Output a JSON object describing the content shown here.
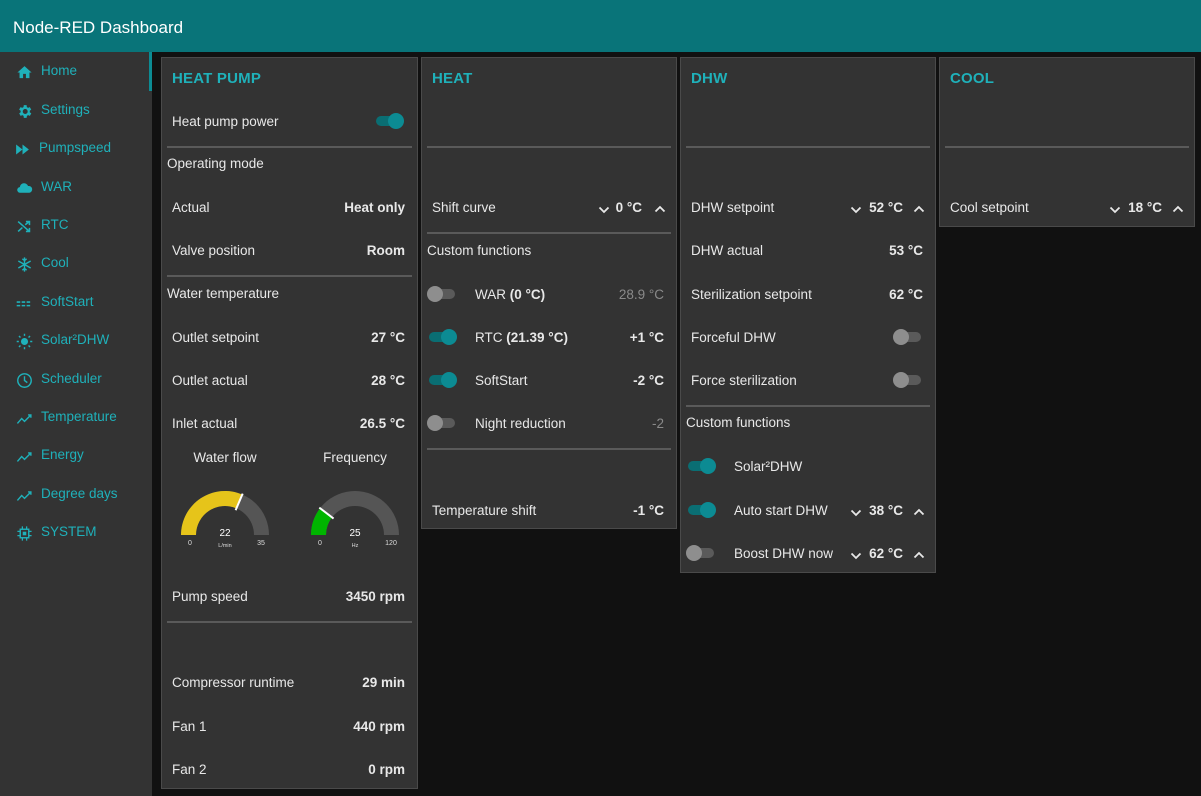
{
  "app": {
    "title": "Node-RED Dashboard"
  },
  "sidebar": {
    "items": [
      {
        "label": "Home",
        "icon": "home-icon"
      },
      {
        "label": "Settings",
        "icon": "gear-icon"
      },
      {
        "label": "Pumpspeed",
        "icon": "fast-forward-icon"
      },
      {
        "label": "WAR",
        "icon": "cloud-icon"
      },
      {
        "label": "RTC",
        "icon": "shuffle-icon"
      },
      {
        "label": "Cool",
        "icon": "snowflake-icon"
      },
      {
        "label": "SoftStart",
        "icon": "dashed-lines-icon"
      },
      {
        "label": "Solar²DHW",
        "icon": "sun-icon"
      },
      {
        "label": "Scheduler",
        "icon": "clock-icon"
      },
      {
        "label": "Temperature",
        "icon": "line-chart-icon"
      },
      {
        "label": "Energy",
        "icon": "line-chart-icon"
      },
      {
        "label": "Degree days",
        "icon": "line-chart-icon"
      },
      {
        "label": "SYSTEM",
        "icon": "chip-icon"
      }
    ]
  },
  "heatpump": {
    "title": "HEAT PUMP",
    "power_label": "Heat pump power",
    "power_on": true,
    "mode_group": "Operating mode",
    "actual_label": "Actual",
    "actual_value": "Heat only",
    "valve_label": "Valve position",
    "valve_value": "Room",
    "water_group": "Water temperature",
    "outlet_set_label": "Outlet setpoint",
    "outlet_set_value": "27 °C",
    "outlet_act_label": "Outlet actual",
    "outlet_act_value": "28 °C",
    "inlet_label": "Inlet actual",
    "inlet_value": "26.5 °C",
    "flow": {
      "label": "Water flow",
      "value": "22",
      "min": "0",
      "max": "35",
      "unit": "L/min",
      "fraction": 0.6286,
      "color": "#e6c41a"
    },
    "freq": {
      "label": "Frequency",
      "value": "25",
      "min": "0",
      "max": "120",
      "unit": "Hz",
      "fraction": 0.2083,
      "color": "#00b500"
    },
    "pump_label": "Pump speed",
    "pump_value": "3450 rpm",
    "runtime_label": "Compressor runtime",
    "runtime_value": "29 min",
    "fan1_label": "Fan 1",
    "fan1_value": "440 rpm",
    "fan2_label": "Fan 2",
    "fan2_value": "0 rpm"
  },
  "heat": {
    "title": "HEAT",
    "shift_label": "Shift curve",
    "shift_value": "0 °C",
    "custom_group": "Custom functions",
    "war_label": "WAR",
    "war_bold": "(0 °C)",
    "war_value": "28.9 °C",
    "war_on": false,
    "rtc_label": "RTC",
    "rtc_bold": "(21.39 °C)",
    "rtc_value": "+1 °C",
    "rtc_on": true,
    "soft_label": "SoftStart",
    "soft_value": "-2 °C",
    "soft_on": true,
    "night_label": "Night reduction",
    "night_value": "-2",
    "night_on": false,
    "tshift_label": "Temperature shift",
    "tshift_value": "-1 °C"
  },
  "dhw": {
    "title": "DHW",
    "set_label": "DHW setpoint",
    "set_value": "52 °C",
    "actual_label": "DHW actual",
    "actual_value": "53 °C",
    "steril_label": "Sterilization setpoint",
    "steril_value": "62 °C",
    "forceful_label": "Forceful DHW",
    "forceful_on": false,
    "force_steril_label": "Force sterilization",
    "force_steril_on": false,
    "custom_group": "Custom functions",
    "solar_label": "Solar²DHW",
    "solar_on": true,
    "autostart_label": "Auto start DHW",
    "autostart_value": "38 °C",
    "autostart_on": true,
    "boost_label": "Boost DHW now",
    "boost_value": "62 °C",
    "boost_on": false
  },
  "cool": {
    "title": "COOL",
    "set_label": "Cool setpoint",
    "set_value": "18 °C"
  },
  "colors": {
    "header": "#097479",
    "accent": "#1fb1ba",
    "panel": "#333333",
    "background": "#111111"
  }
}
